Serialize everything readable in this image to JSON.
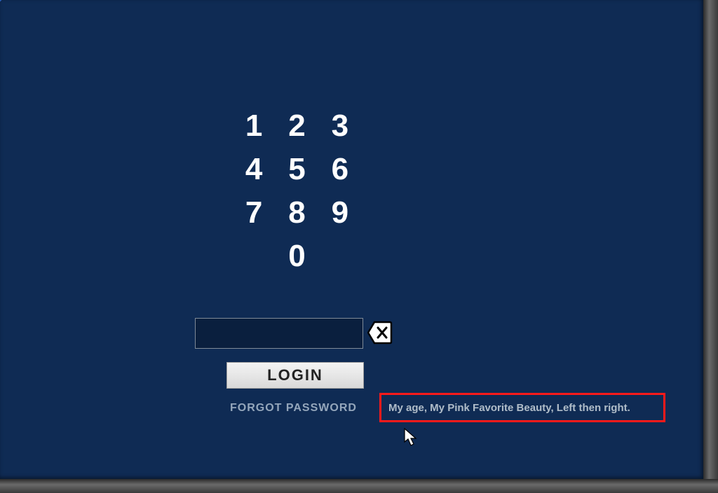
{
  "keypad": {
    "keys": [
      "1",
      "2",
      "3",
      "4",
      "5",
      "6",
      "7",
      "8",
      "9",
      "0"
    ]
  },
  "login": {
    "button_label": "LOGIN",
    "forgot_label": "FORGOT PASSWORD",
    "password_value": ""
  },
  "hint": {
    "text": "My age, My Pink Favorite Beauty, Left then right."
  }
}
